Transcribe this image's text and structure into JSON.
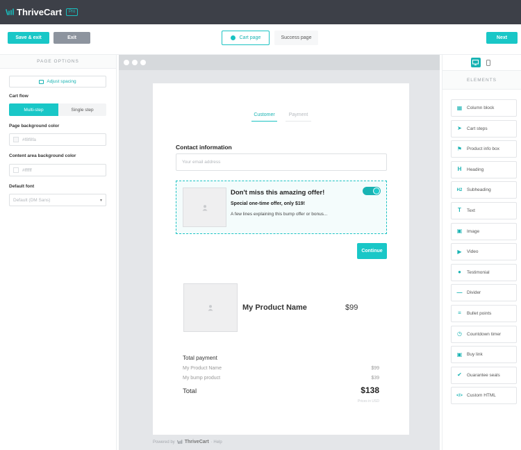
{
  "app": {
    "name": "ThriveCart",
    "badge": "Pro"
  },
  "toolbar": {
    "save_exit": "Save & exit",
    "exit": "Exit",
    "next": "Next",
    "tabs": [
      {
        "label": "Cart page",
        "active": true
      },
      {
        "label": "Success page",
        "active": false
      }
    ]
  },
  "left_panel": {
    "title": "PAGE OPTIONS",
    "adjust_spacing": "Adjust spacing",
    "cart_flow_label": "Cart flow",
    "cart_flow_options": [
      "Multi-step",
      "Single step"
    ],
    "page_bg_label": "Page background color",
    "page_bg_value": "#f8f8fa",
    "content_bg_label": "Content area background color",
    "content_bg_value": "#ffffff",
    "default_font_label": "Default font",
    "default_font_value": "Default (DM Sans)"
  },
  "cart": {
    "steps": [
      "Customer",
      "Payment"
    ],
    "contact_title": "Contact information",
    "email_placeholder": "Your email address",
    "bump": {
      "title": "Don't miss this amazing offer!",
      "subtitle": "Special one-time offer, only $19!",
      "description": "A few lines explaining this bump offer or bonus..."
    },
    "continue": "Continue",
    "product": {
      "name": "My Product Name",
      "price": "$99"
    },
    "summary": {
      "label": "Total payment",
      "items": [
        {
          "name": "My Product Name",
          "price": "$99"
        },
        {
          "name": "My bump product",
          "price": "$39"
        }
      ],
      "total_label": "Total",
      "total_value": "$138",
      "note": "Prices in USD"
    }
  },
  "footer": {
    "prefix": "Powered by",
    "brand": "ThriveCart",
    "suffix": "· Help"
  },
  "right_panel": {
    "title": "ELEMENTS",
    "items": [
      {
        "label": "Column block",
        "icon": "columns-icon"
      },
      {
        "label": "Cart steps",
        "icon": "steps-icon"
      },
      {
        "label": "Product info box",
        "icon": "flag-icon"
      },
      {
        "label": "Heading",
        "icon": "heading-icon"
      },
      {
        "label": "Subheading",
        "icon": "subheading-icon"
      },
      {
        "label": "Text",
        "icon": "text-icon"
      },
      {
        "label": "Image",
        "icon": "image-icon"
      },
      {
        "label": "Video",
        "icon": "video-icon"
      },
      {
        "label": "Testimonial",
        "icon": "users-icon"
      },
      {
        "label": "Divider",
        "icon": "divider-icon"
      },
      {
        "label": "Bullet points",
        "icon": "list-icon"
      },
      {
        "label": "Countdown timer",
        "icon": "clock-icon"
      },
      {
        "label": "Buy link",
        "icon": "cart-icon"
      },
      {
        "label": "Guarantee seals",
        "icon": "badge-icon"
      },
      {
        "label": "Custom HTML",
        "icon": "code-icon"
      }
    ]
  },
  "colors": {
    "accent": "#19c7c7",
    "topbar": "#3d4048",
    "exit_button": "#8d949e"
  }
}
